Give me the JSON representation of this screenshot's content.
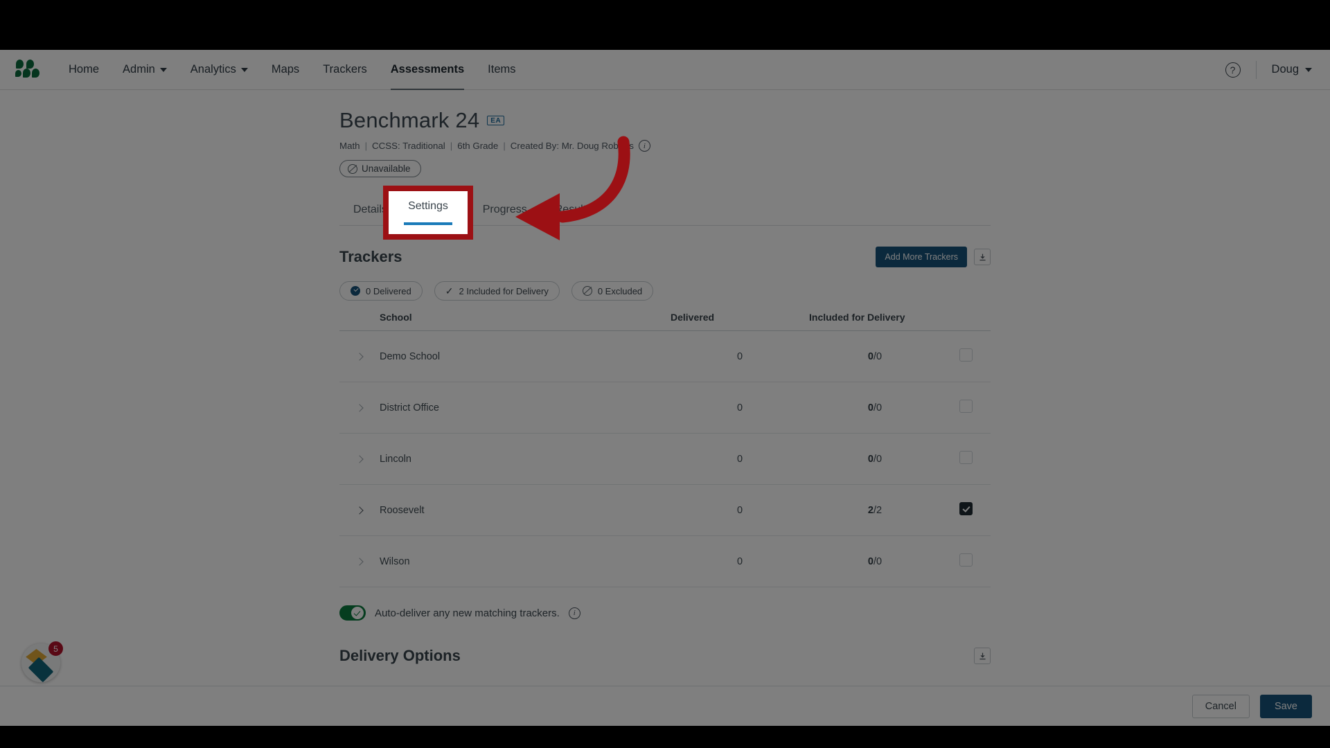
{
  "nav": {
    "logo_name": "schoolcity-logo",
    "items": [
      {
        "label": "Home",
        "has_caret": false,
        "active": false
      },
      {
        "label": "Admin",
        "has_caret": true,
        "active": false
      },
      {
        "label": "Analytics",
        "has_caret": true,
        "active": false
      },
      {
        "label": "Maps",
        "has_caret": false,
        "active": false
      },
      {
        "label": "Trackers",
        "has_caret": false,
        "active": false
      },
      {
        "label": "Assessments",
        "has_caret": false,
        "active": true
      },
      {
        "label": "Items",
        "has_caret": false,
        "active": false
      }
    ],
    "help_icon": "question-circle-icon",
    "user": "Doug"
  },
  "header": {
    "title": "Benchmark 24",
    "badge": "EA",
    "meta": {
      "subject": "Math",
      "standard": "CCSS: Traditional",
      "grade": "6th Grade",
      "creator": "Created By: Mr. Doug Roberts",
      "separator": "|",
      "info_icon": "info-circle-icon"
    },
    "status_pill": {
      "label": "Unavailable",
      "icon": "ban-icon"
    }
  },
  "tabs": {
    "items": [
      {
        "label": "Details",
        "selected": false
      },
      {
        "label": "Settings",
        "selected": true
      },
      {
        "label": "Progress",
        "selected": false
      },
      {
        "label": "Results",
        "selected": false
      }
    ],
    "highlight_color": "#9c1014",
    "active_underline_color": "#1b7bb9"
  },
  "annotation": {
    "box_target": "Settings",
    "arrow_color": "#9c1014"
  },
  "trackers": {
    "section_title": "Trackers",
    "add_button": "Add More Trackers",
    "collapse_icon": "collapse-section-icon",
    "chips": [
      {
        "label": "0 Delivered",
        "icon": "download-circle-icon"
      },
      {
        "label": "2 Included for Delivery",
        "icon": "check-icon"
      },
      {
        "label": "0 Excluded",
        "icon": "ban-icon"
      }
    ],
    "columns": [
      "School",
      "Delivered",
      "Included for Delivery"
    ],
    "rows": [
      {
        "school": "Demo School",
        "delivered": "0",
        "included": "0",
        "total": "0",
        "checked": false,
        "expandable": false
      },
      {
        "school": "District Office",
        "delivered": "0",
        "included": "0",
        "total": "0",
        "checked": false,
        "expandable": false
      },
      {
        "school": "Lincoln",
        "delivered": "0",
        "included": "0",
        "total": "0",
        "checked": false,
        "expandable": false
      },
      {
        "school": "Roosevelt",
        "delivered": "0",
        "included": "2",
        "total": "2",
        "checked": true,
        "expandable": true
      },
      {
        "school": "Wilson",
        "delivered": "0",
        "included": "0",
        "total": "0",
        "checked": false,
        "expandable": false
      }
    ],
    "auto_deliver": {
      "label": "Auto-deliver any new matching trackers.",
      "enabled": true,
      "info_icon": "info-circle-icon",
      "toggle_color": "#0b7a3e"
    }
  },
  "delivery_options": {
    "section_title": "Delivery Options",
    "collapse_icon": "collapse-section-icon"
  },
  "footer": {
    "cancel_label": "Cancel",
    "save_label": "Save",
    "save_color": "#17537a"
  },
  "fab": {
    "name": "help-widget",
    "badge_count": "5",
    "badge_color": "#b3122b"
  }
}
